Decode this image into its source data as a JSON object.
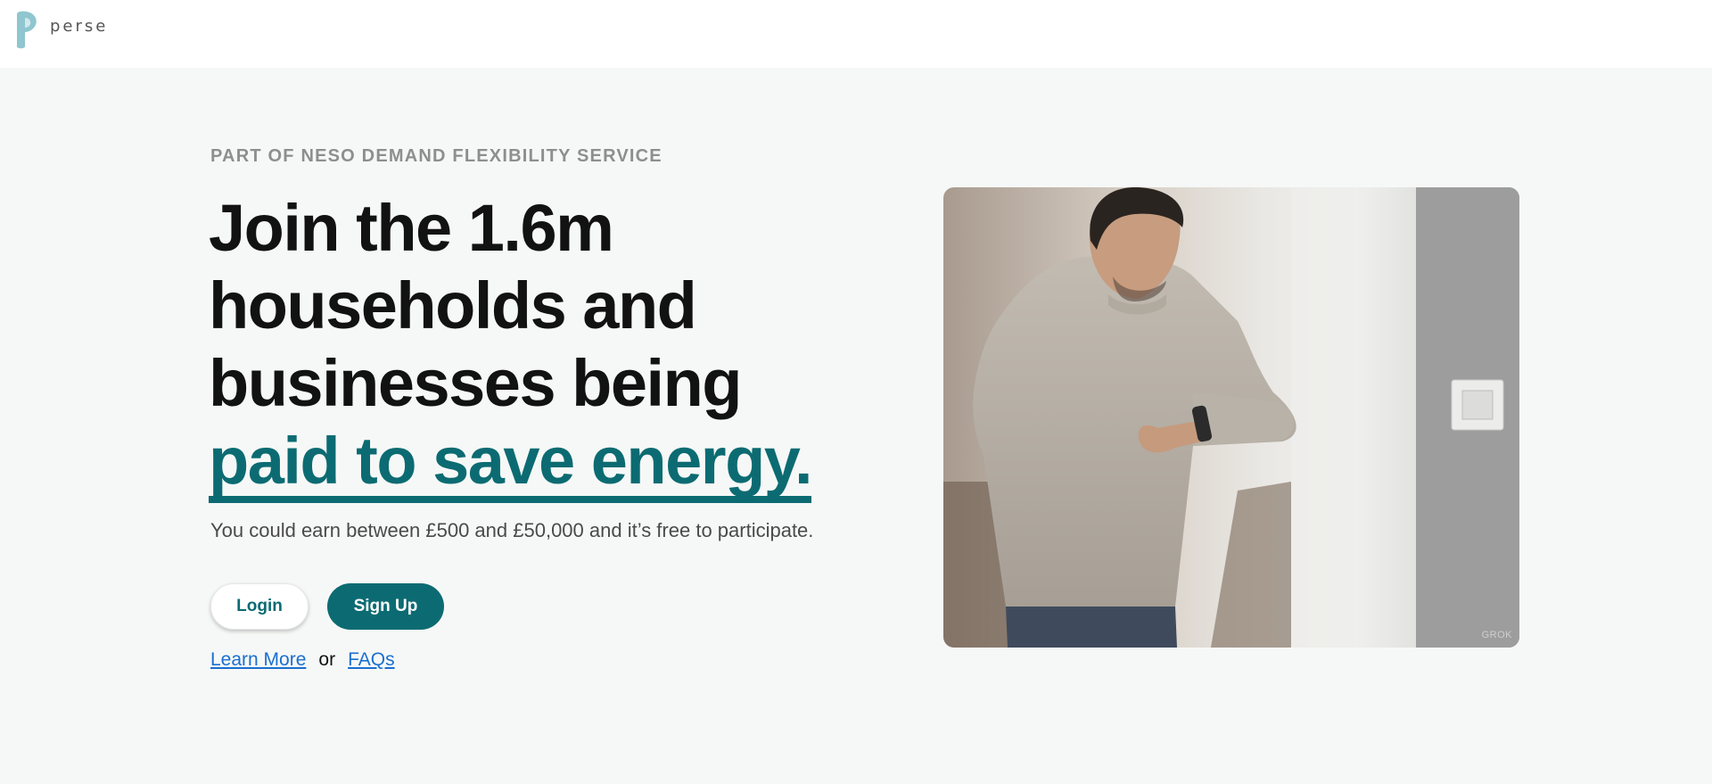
{
  "brand": {
    "name": "perse",
    "accent_color": "#0c6b72",
    "logo_color": "#8fc6cf"
  },
  "hero": {
    "kicker": "PART OF NESO DEMAND FLEXIBILITY SERVICE",
    "headline_lines": [
      "Join the 1.6m",
      "households and",
      "businesses being"
    ],
    "headline_accent": "paid to save energy.",
    "subtext": "You could earn between £500 and £50,000 and it’s free to participate.",
    "buttons": {
      "login": "Login",
      "signup": "Sign Up"
    },
    "links": {
      "learn_more": "Learn More ",
      "separator": "or",
      "faqs": " FAQs"
    }
  },
  "image": {
    "watermark": "GROK"
  }
}
